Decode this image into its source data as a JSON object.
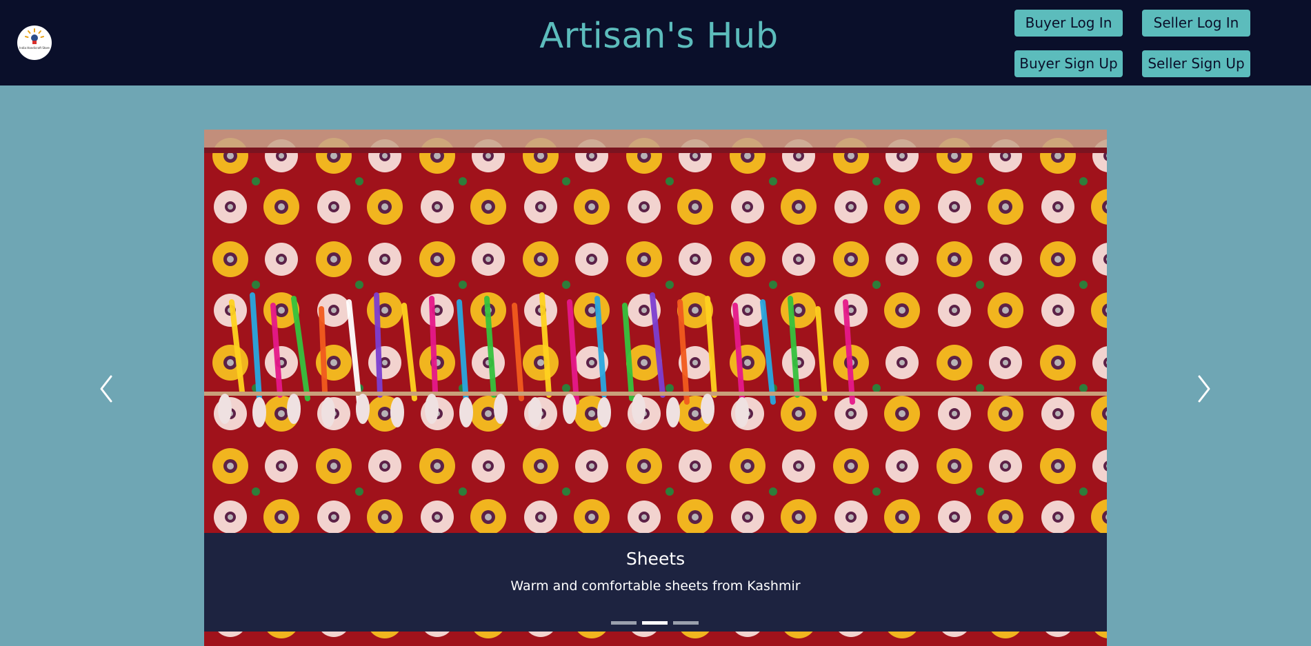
{
  "header": {
    "logo_text": "India Handicraft Store",
    "title": "Artisan's Hub",
    "buttons": {
      "buyer_login": "Buyer Log In",
      "seller_login": "Seller Log In",
      "buyer_signup": "Buyer Sign Up",
      "seller_signup": "Seller Sign Up"
    }
  },
  "carousel": {
    "caption_title": "Sheets",
    "caption_text": "Warm and comfortable sheets from Kashmir",
    "indicator_count": 3,
    "active_indicator": 1,
    "prev_icon": "chevron-left-icon",
    "next_icon": "chevron-right-icon"
  },
  "colors": {
    "topbar": "#0a0f2a",
    "accent": "#5cbcbc",
    "page_background": "#6fa6b4",
    "caption_panel": "#1d2340"
  }
}
